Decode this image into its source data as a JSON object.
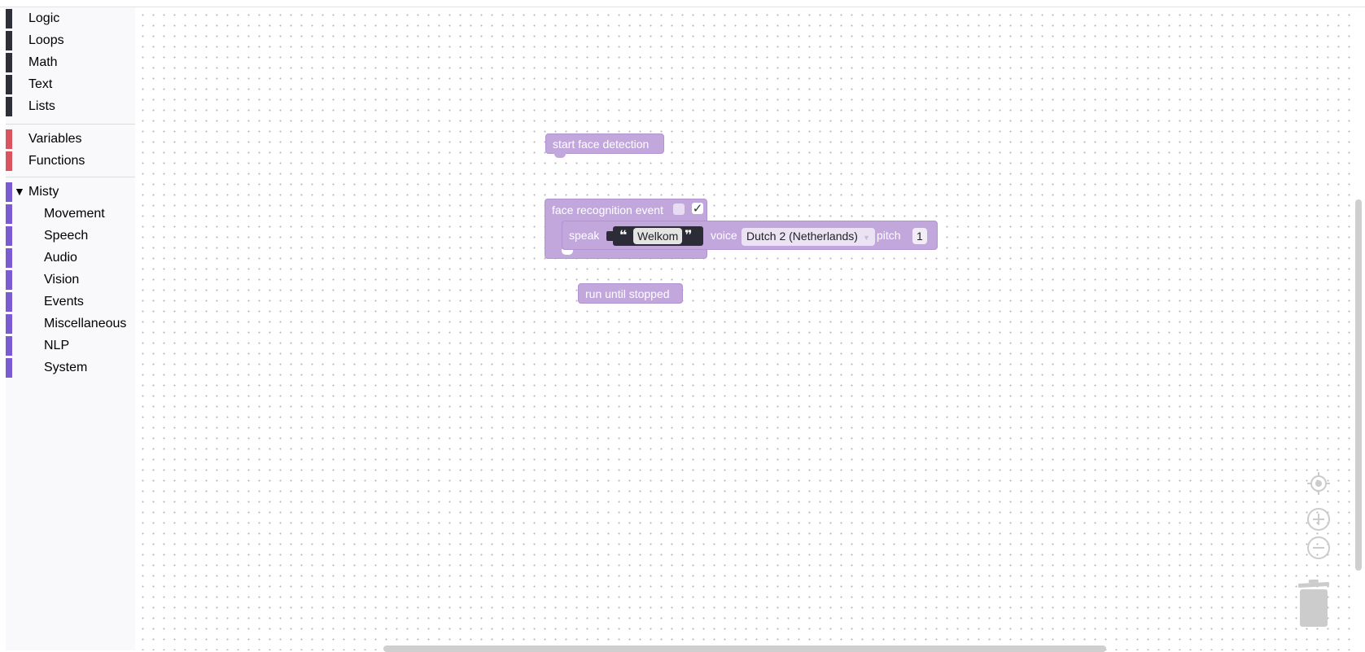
{
  "toolbox": {
    "items": [
      {
        "label": "Logic",
        "color": "#2f2f3a"
      },
      {
        "label": "Loops",
        "color": "#2f2f3a"
      },
      {
        "label": "Math",
        "color": "#2f2f3a"
      },
      {
        "label": "Text",
        "color": "#2f2f3a"
      },
      {
        "label": "Lists",
        "color": "#2f2f3a"
      },
      {
        "label": "Variables",
        "color": "#d9545f"
      },
      {
        "label": "Functions",
        "color": "#d9545f"
      }
    ],
    "group": {
      "label": "Misty",
      "arrow": "▼",
      "color": "#7b5bd1"
    },
    "subitems": [
      {
        "label": "Movement"
      },
      {
        "label": "Speech"
      },
      {
        "label": "Audio"
      },
      {
        "label": "Vision"
      },
      {
        "label": "Events"
      },
      {
        "label": "Miscellaneous"
      },
      {
        "label": "NLP"
      },
      {
        "label": "System"
      }
    ]
  },
  "blocks": {
    "start_face": {
      "label": "start face detection"
    },
    "face_event": {
      "label": "face recognition event",
      "check_mark": "✓",
      "speak_label": "speak",
      "quote_open": "❝",
      "quote_close": "❞",
      "text_value": "Welkom",
      "voice_label": "voice",
      "voice_value": "Dutch 2 (Netherlands)",
      "voice_caret": "▼",
      "pitch_label": "pitch",
      "pitch_value": "1"
    },
    "run_until": {
      "label": "run until stopped"
    }
  },
  "colors": {
    "block_fill": "#c2a7dc",
    "text_block": "#2c2c37",
    "control_gray": "#cccccc"
  },
  "icons": {
    "recenter": "target-icon",
    "zoom_in": "plus-icon",
    "zoom_out": "minus-icon",
    "trash": "trash-icon"
  }
}
